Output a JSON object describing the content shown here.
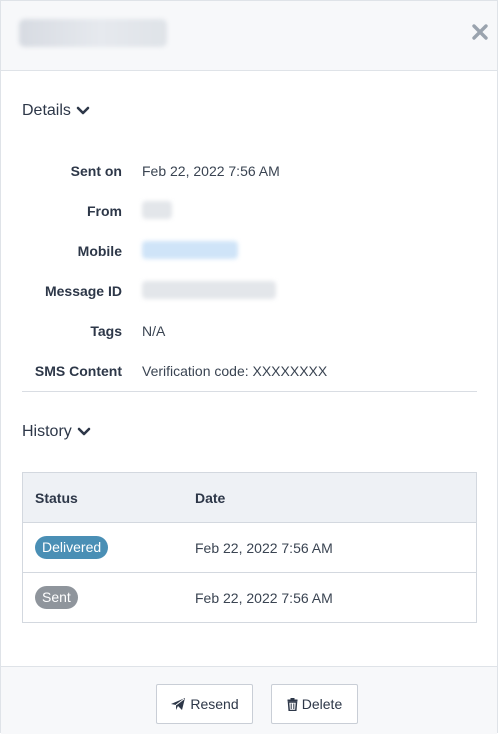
{
  "header": {
    "title": "",
    "close_icon": "close-icon"
  },
  "details": {
    "heading": "Details",
    "rows": [
      {
        "label": "Sent on",
        "value": "Feb 22, 2022 7:56 AM"
      },
      {
        "label": "From",
        "value": ""
      },
      {
        "label": "Mobile",
        "value": ""
      },
      {
        "label": "Message ID",
        "value": ""
      },
      {
        "label": "Tags",
        "value": "N/A"
      },
      {
        "label": "SMS Content",
        "value": "Verification code: XXXXXXXX"
      }
    ]
  },
  "history": {
    "heading": "History",
    "columns": [
      "Status",
      "Date"
    ],
    "rows": [
      {
        "status": "Delivered",
        "status_color": "#4a8fb5",
        "date": "Feb 22, 2022 7:56 AM"
      },
      {
        "status": "Sent",
        "status_color": "#8f959c",
        "date": "Feb 22, 2022 7:56 AM"
      }
    ]
  },
  "footer": {
    "resend_label": "Resend",
    "delete_label": "Delete",
    "resend_icon": "paper-plane-icon",
    "delete_icon": "trash-icon"
  },
  "colors": {
    "link": "#3d9be9",
    "delivered": "#4a8fb5",
    "sent": "#8f959c"
  }
}
